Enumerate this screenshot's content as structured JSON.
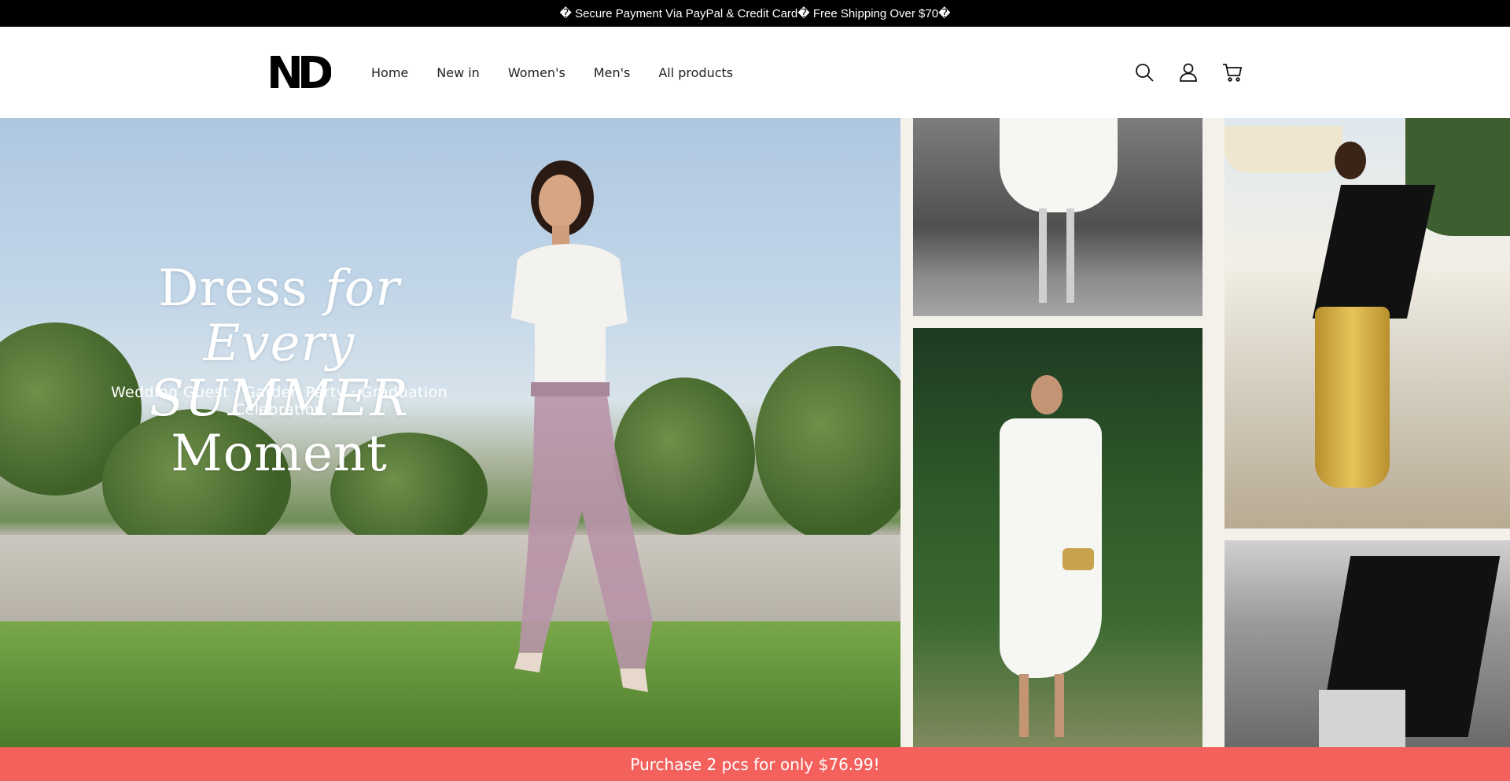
{
  "announcement": {
    "text": "� Secure Payment Via PayPal & Credit Card� Free Shipping Over $70�"
  },
  "header": {
    "logo_text": "ND",
    "nav": [
      {
        "label": "Home"
      },
      {
        "label": "New in"
      },
      {
        "label": "Women's"
      },
      {
        "label": "Men's"
      },
      {
        "label": "All products"
      }
    ],
    "icons": [
      "search-icon",
      "account-icon",
      "cart-icon"
    ]
  },
  "hero": {
    "title_line1_plain": "Dress",
    "title_line1_italic": "for Every",
    "title_line2_italic": "SUMMER",
    "title_line2_plain": "Moment",
    "subtitle": "Wedding Guest · Garden Party · Graduation Celebration"
  },
  "promo": {
    "text": "Purchase 2 pcs for only $76.99!"
  },
  "colors": {
    "announcement_bg": "#000000",
    "promo_bg": "#f4615d",
    "accent_text": "#ffffff"
  }
}
